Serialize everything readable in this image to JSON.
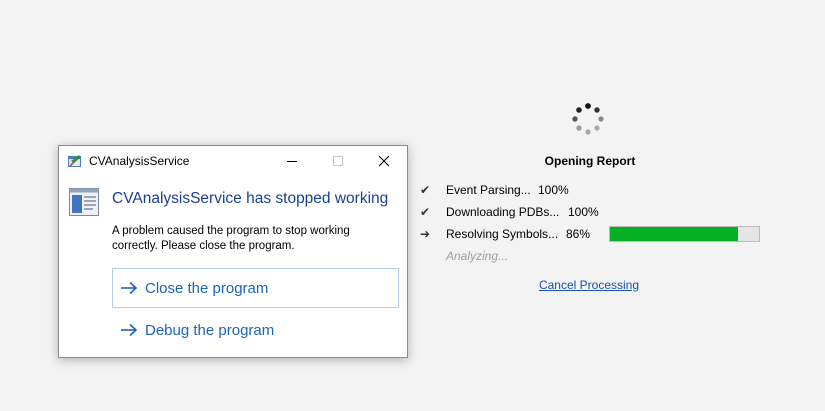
{
  "dialog": {
    "title": "CVAnalysisService",
    "headline": "CVAnalysisService has stopped working",
    "message": "A problem caused the program to stop working correctly. Please close the program.",
    "commands": [
      {
        "label": "Close the program",
        "icon": "arrow-right-icon"
      },
      {
        "label": "Debug the program",
        "icon": "arrow-right-icon"
      }
    ],
    "window_buttons": [
      "minimize-icon",
      "maximize-icon",
      "close-icon"
    ]
  },
  "report": {
    "title": "Opening Report",
    "steps": [
      {
        "status": "done",
        "mark": "✔",
        "label": "Event Parsing...",
        "percent": "100%"
      },
      {
        "status": "done",
        "mark": "✔",
        "label": "Downloading PDBs...",
        "percent": "100%"
      },
      {
        "status": "active",
        "mark": "➔",
        "label": "Resolving Symbols...",
        "percent": "86%",
        "progress": 0.86
      }
    ],
    "sub_status": "Analyzing...",
    "cancel_label": "Cancel Processing"
  },
  "colors": {
    "headline": "#1c3f96",
    "command_link": "#1d63b9",
    "progress_fill": "#06b025",
    "link": "#1a4fb0",
    "background": "#f3f3f3"
  }
}
